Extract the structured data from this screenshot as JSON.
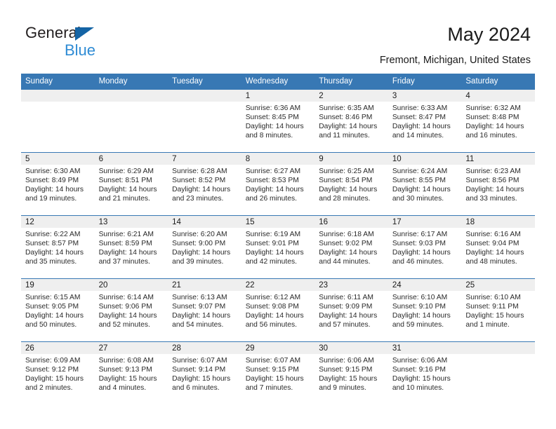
{
  "brand": {
    "name_part1": "General",
    "name_part2": "Blue",
    "accent_color": "#1464a5",
    "blue_text_color": "#2e8bd4"
  },
  "header": {
    "title": "May 2024",
    "subtitle": "Fremont, Michigan, United States"
  },
  "calendar": {
    "header_bg": "#3878b4",
    "daynum_bg": "#efefef",
    "weekdays": [
      "Sunday",
      "Monday",
      "Tuesday",
      "Wednesday",
      "Thursday",
      "Friday",
      "Saturday"
    ],
    "weeks": [
      [
        {
          "day": "",
          "sunrise": "",
          "sunset": "",
          "daylight": ""
        },
        {
          "day": "",
          "sunrise": "",
          "sunset": "",
          "daylight": ""
        },
        {
          "day": "",
          "sunrise": "",
          "sunset": "",
          "daylight": ""
        },
        {
          "day": "1",
          "sunrise": "Sunrise: 6:36 AM",
          "sunset": "Sunset: 8:45 PM",
          "daylight": "Daylight: 14 hours and 8 minutes."
        },
        {
          "day": "2",
          "sunrise": "Sunrise: 6:35 AM",
          "sunset": "Sunset: 8:46 PM",
          "daylight": "Daylight: 14 hours and 11 minutes."
        },
        {
          "day": "3",
          "sunrise": "Sunrise: 6:33 AM",
          "sunset": "Sunset: 8:47 PM",
          "daylight": "Daylight: 14 hours and 14 minutes."
        },
        {
          "day": "4",
          "sunrise": "Sunrise: 6:32 AM",
          "sunset": "Sunset: 8:48 PM",
          "daylight": "Daylight: 14 hours and 16 minutes."
        }
      ],
      [
        {
          "day": "5",
          "sunrise": "Sunrise: 6:30 AM",
          "sunset": "Sunset: 8:49 PM",
          "daylight": "Daylight: 14 hours and 19 minutes."
        },
        {
          "day": "6",
          "sunrise": "Sunrise: 6:29 AM",
          "sunset": "Sunset: 8:51 PM",
          "daylight": "Daylight: 14 hours and 21 minutes."
        },
        {
          "day": "7",
          "sunrise": "Sunrise: 6:28 AM",
          "sunset": "Sunset: 8:52 PM",
          "daylight": "Daylight: 14 hours and 23 minutes."
        },
        {
          "day": "8",
          "sunrise": "Sunrise: 6:27 AM",
          "sunset": "Sunset: 8:53 PM",
          "daylight": "Daylight: 14 hours and 26 minutes."
        },
        {
          "day": "9",
          "sunrise": "Sunrise: 6:25 AM",
          "sunset": "Sunset: 8:54 PM",
          "daylight": "Daylight: 14 hours and 28 minutes."
        },
        {
          "day": "10",
          "sunrise": "Sunrise: 6:24 AM",
          "sunset": "Sunset: 8:55 PM",
          "daylight": "Daylight: 14 hours and 30 minutes."
        },
        {
          "day": "11",
          "sunrise": "Sunrise: 6:23 AM",
          "sunset": "Sunset: 8:56 PM",
          "daylight": "Daylight: 14 hours and 33 minutes."
        }
      ],
      [
        {
          "day": "12",
          "sunrise": "Sunrise: 6:22 AM",
          "sunset": "Sunset: 8:57 PM",
          "daylight": "Daylight: 14 hours and 35 minutes."
        },
        {
          "day": "13",
          "sunrise": "Sunrise: 6:21 AM",
          "sunset": "Sunset: 8:59 PM",
          "daylight": "Daylight: 14 hours and 37 minutes."
        },
        {
          "day": "14",
          "sunrise": "Sunrise: 6:20 AM",
          "sunset": "Sunset: 9:00 PM",
          "daylight": "Daylight: 14 hours and 39 minutes."
        },
        {
          "day": "15",
          "sunrise": "Sunrise: 6:19 AM",
          "sunset": "Sunset: 9:01 PM",
          "daylight": "Daylight: 14 hours and 42 minutes."
        },
        {
          "day": "16",
          "sunrise": "Sunrise: 6:18 AM",
          "sunset": "Sunset: 9:02 PM",
          "daylight": "Daylight: 14 hours and 44 minutes."
        },
        {
          "day": "17",
          "sunrise": "Sunrise: 6:17 AM",
          "sunset": "Sunset: 9:03 PM",
          "daylight": "Daylight: 14 hours and 46 minutes."
        },
        {
          "day": "18",
          "sunrise": "Sunrise: 6:16 AM",
          "sunset": "Sunset: 9:04 PM",
          "daylight": "Daylight: 14 hours and 48 minutes."
        }
      ],
      [
        {
          "day": "19",
          "sunrise": "Sunrise: 6:15 AM",
          "sunset": "Sunset: 9:05 PM",
          "daylight": "Daylight: 14 hours and 50 minutes."
        },
        {
          "day": "20",
          "sunrise": "Sunrise: 6:14 AM",
          "sunset": "Sunset: 9:06 PM",
          "daylight": "Daylight: 14 hours and 52 minutes."
        },
        {
          "day": "21",
          "sunrise": "Sunrise: 6:13 AM",
          "sunset": "Sunset: 9:07 PM",
          "daylight": "Daylight: 14 hours and 54 minutes."
        },
        {
          "day": "22",
          "sunrise": "Sunrise: 6:12 AM",
          "sunset": "Sunset: 9:08 PM",
          "daylight": "Daylight: 14 hours and 56 minutes."
        },
        {
          "day": "23",
          "sunrise": "Sunrise: 6:11 AM",
          "sunset": "Sunset: 9:09 PM",
          "daylight": "Daylight: 14 hours and 57 minutes."
        },
        {
          "day": "24",
          "sunrise": "Sunrise: 6:10 AM",
          "sunset": "Sunset: 9:10 PM",
          "daylight": "Daylight: 14 hours and 59 minutes."
        },
        {
          "day": "25",
          "sunrise": "Sunrise: 6:10 AM",
          "sunset": "Sunset: 9:11 PM",
          "daylight": "Daylight: 15 hours and 1 minute."
        }
      ],
      [
        {
          "day": "26",
          "sunrise": "Sunrise: 6:09 AM",
          "sunset": "Sunset: 9:12 PM",
          "daylight": "Daylight: 15 hours and 2 minutes."
        },
        {
          "day": "27",
          "sunrise": "Sunrise: 6:08 AM",
          "sunset": "Sunset: 9:13 PM",
          "daylight": "Daylight: 15 hours and 4 minutes."
        },
        {
          "day": "28",
          "sunrise": "Sunrise: 6:07 AM",
          "sunset": "Sunset: 9:14 PM",
          "daylight": "Daylight: 15 hours and 6 minutes."
        },
        {
          "day": "29",
          "sunrise": "Sunrise: 6:07 AM",
          "sunset": "Sunset: 9:15 PM",
          "daylight": "Daylight: 15 hours and 7 minutes."
        },
        {
          "day": "30",
          "sunrise": "Sunrise: 6:06 AM",
          "sunset": "Sunset: 9:15 PM",
          "daylight": "Daylight: 15 hours and 9 minutes."
        },
        {
          "day": "31",
          "sunrise": "Sunrise: 6:06 AM",
          "sunset": "Sunset: 9:16 PM",
          "daylight": "Daylight: 15 hours and 10 minutes."
        },
        {
          "day": "",
          "sunrise": "",
          "sunset": "",
          "daylight": ""
        }
      ]
    ]
  }
}
